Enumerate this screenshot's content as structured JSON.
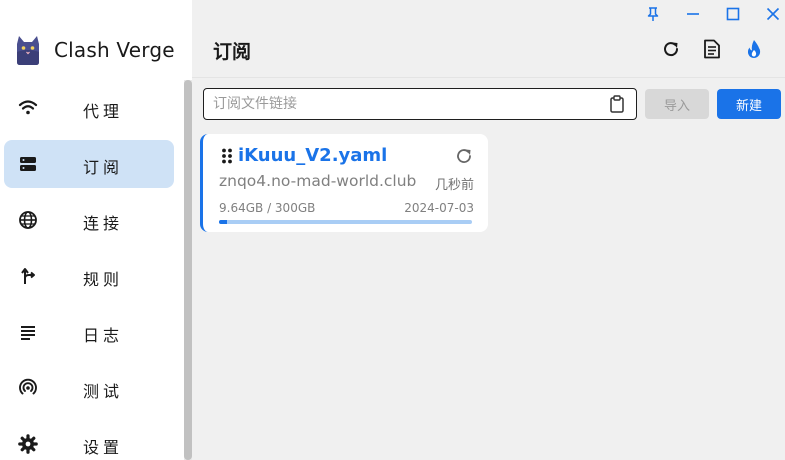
{
  "app": {
    "name": "Clash Verge"
  },
  "sidebar": {
    "items": [
      {
        "label": "代理",
        "icon": "wifi-icon",
        "active": false
      },
      {
        "label": "订阅",
        "icon": "dns-icon",
        "active": true
      },
      {
        "label": "连接",
        "icon": "globe-icon",
        "active": false
      },
      {
        "label": "规则",
        "icon": "fork-icon",
        "active": false
      },
      {
        "label": "日志",
        "icon": "lines-icon",
        "active": false
      },
      {
        "label": "测试",
        "icon": "radar-icon",
        "active": false
      },
      {
        "label": "设置",
        "icon": "gear-icon",
        "active": false
      }
    ]
  },
  "header": {
    "title": "订阅"
  },
  "toolbar": {
    "url_input": {
      "placeholder": "订阅文件链接",
      "value": ""
    },
    "import_label": "导入",
    "new_label": "新建"
  },
  "profiles": [
    {
      "name": "iKuuu_V2.yaml",
      "host": "znqo4.no-mad-world.club",
      "updated": "几秒前",
      "usage": "9.64GB / 300GB",
      "used_fraction": 0.032,
      "expire": "2024-07-03"
    }
  ],
  "colors": {
    "accent": "#1a73e8",
    "active_nav_bg": "#cfe2f6",
    "main_bg": "#f0f0f0",
    "progress_bg": "#a9cdf5"
  }
}
